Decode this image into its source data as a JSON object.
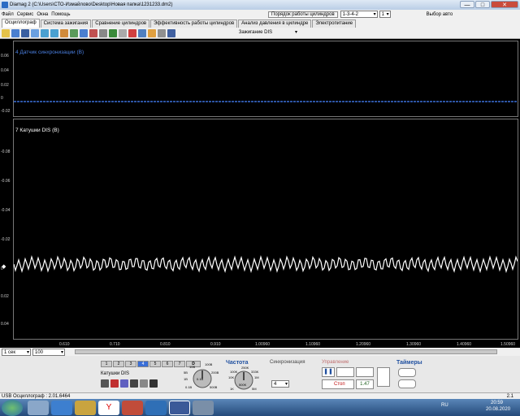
{
  "window": {
    "title": "Diamag 2 (C:\\Users\\СТО-Измайлово\\Desktop\\Новая папка\\1231233.dm2)",
    "min": "—",
    "max": "□",
    "close": "✕"
  },
  "menu": [
    "Файл",
    "Сервис",
    "Окна",
    "Помощь"
  ],
  "header": {
    "firing_order_label": "Порядок работы цилиндров",
    "firing_order_value": "1-3-4-2",
    "cylinder_value": "1",
    "mode_value": "Выбор авто"
  },
  "tabs": [
    "Осциллограф",
    "Система зажигания",
    "Сравнение цилиндров",
    "Эффективность работы цилиндров",
    "Анализ давления в цилиндре",
    "Электропитание"
  ],
  "toolbar": {
    "ignition_dropdown": "Зажигание DIS"
  },
  "panel1": {
    "label": "4 Датчик синхронизации (В)",
    "ticks": [
      "0.06",
      "0.04",
      "0.02",
      "0",
      "-0.02"
    ]
  },
  "panel2": {
    "label": "7 Катушки DIS (В)",
    "ticks": [
      "-0.08",
      "-0.06",
      "-0.04",
      "-0.02",
      "0",
      "0.02",
      "0.04"
    ]
  },
  "xaxis": {
    "ticks": [
      "0.610",
      "0.710",
      "0.810",
      "0.910",
      "1.00960",
      "1.10960",
      "1.20960",
      "1.30960",
      "1.40960",
      "1.50960"
    ]
  },
  "bottom": {
    "timebase": "1 сек",
    "zoom": "100"
  },
  "controls": {
    "channel_buttons": [
      "1",
      "2",
      "3",
      "4",
      "5",
      "6",
      "7",
      "D"
    ],
    "coil_label": "Катушки DIS",
    "range_knob_labels": [
      "10В",
      "100В",
      "5В",
      "200В",
      "1В",
      "0.1В",
      "0.1В",
      "500В"
    ],
    "freq_title": "Частота",
    "freq_knob_labels": [
      "250K",
      "100K",
      "333K",
      "10K",
      "1M",
      "500K",
      "1K",
      "5M"
    ],
    "sync_title": "Синхронизация",
    "sync_value": "4",
    "control_title": "Управление",
    "stop_label": "Стоп",
    "value_label": "1.47",
    "timers_title": "Таймеры"
  },
  "status": {
    "text": "USB Осциллограф : 2.01.6464",
    "right": "2.1"
  },
  "taskbar": {
    "lang": "RU",
    "time": "20:59",
    "date": "20.08.2020"
  },
  "colors": {
    "trace": "#ffffff",
    "sync_trace": "#3a6fd8",
    "background": "#000000"
  }
}
